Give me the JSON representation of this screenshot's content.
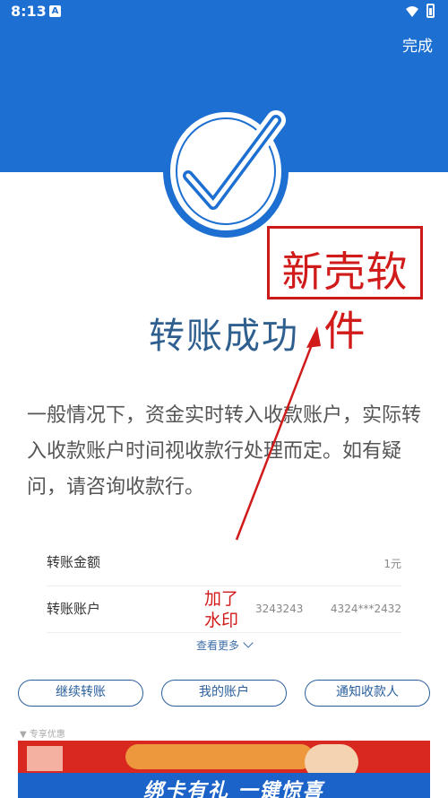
{
  "status_bar": {
    "time": "8:13",
    "notification_icon_letter": "A"
  },
  "header": {
    "done_label": "完成",
    "bg_color": "#1d6fd1"
  },
  "result": {
    "title": "转账成功",
    "icon": "check-circle-icon"
  },
  "watermark_box": {
    "text": "新壳软件",
    "color": "#d11a1a"
  },
  "notice": {
    "text": "一般情况下，资金实时转入收款账户，实际转入收款账户时间视收款行处理而定。如有疑问，请咨询收款行。"
  },
  "details": {
    "amount_label": "转账金额",
    "amount_value": "1元",
    "account_label": "转账账户",
    "account_number_1": "3243243",
    "account_number_2": "4324***2432"
  },
  "annotation": {
    "line1": "加了",
    "line2": "水印"
  },
  "see_more": {
    "label": "查看更多"
  },
  "actions": {
    "continue_label": "继续转账",
    "my_account_label": "我的账户",
    "notify_label": "通知收款人"
  },
  "ad": {
    "hint": "▼ 专享优惠",
    "text": "绑卡有礼 一键惊喜"
  }
}
